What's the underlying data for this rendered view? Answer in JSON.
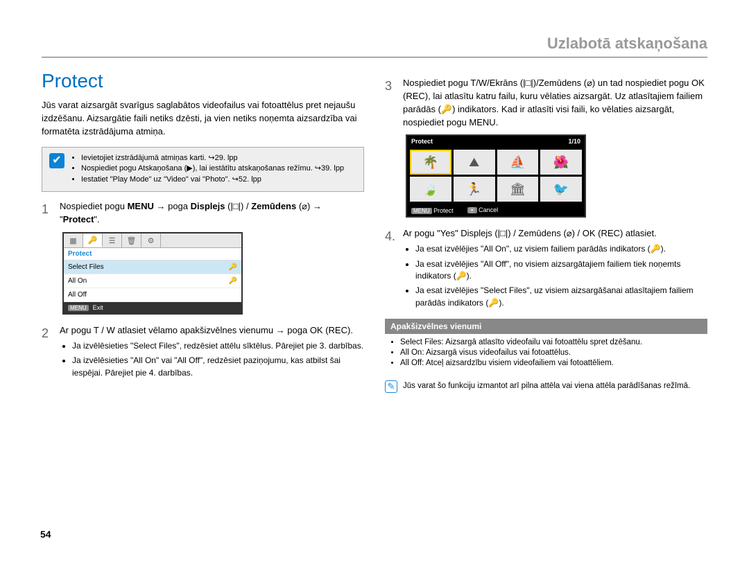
{
  "header": {
    "breadcrumb": "Uzlabotā atskaņošana"
  },
  "section": {
    "title": "Protect"
  },
  "intro": "Jūs varat aizsargāt svarīgus saglabātos videofailus vai fotoattēlus pret nejaušu izdzēšanu. Aizsargātie faili netiks dzēsti, ja vien netiks noņemta aizsardzība vai formatēta izstrādājuma atmiņa.",
  "infobox": {
    "items": [
      "Ievietojiet izstrādājumā atmiņas karti. ↪29. lpp",
      "Nospiediet pogu Atskaņošana (▶), lai iestātītu atskaņošanas režīmu. ↪39. lpp",
      "Iestatiet \"Play Mode\" uz \"Video\" vai \"Photo\". ↪52. lpp"
    ]
  },
  "step1": {
    "num": "1",
    "text_before": "Nospiediet pogu ",
    "bold1": "MENU",
    "arrow1": " → poga ",
    "bold2": "Displejs",
    "disp_icon": " (|□|) / ",
    "bold3": "Zemūdens",
    "after": " (⌀) → \"",
    "bold4": "Protect",
    "end": "\"."
  },
  "menu1": {
    "title": "Protect",
    "items": [
      "Select Files",
      "All On",
      "All Off"
    ],
    "exit": "Exit",
    "menu_key": "MENU"
  },
  "step2": {
    "num": "2",
    "text": "Ar pogu T / W atlasiet vēlamo apakšizvēlnes vienumu → poga OK (REC).",
    "bullets": [
      "Ja izvēlēsieties \"Select Files\", redzēsiet attēlu sīktēlus. Pārejiet pie 3. darbības.",
      "Ja izvēlēsieties \"All On\" vai \"All Off\", redzēsiet paziņojumu, kas atbilst šai iespējai. Pārejiet pie 4. darbības."
    ]
  },
  "step3": {
    "num": "3",
    "text": "Nospiediet pogu T/W/Ekrāns (|□|)/Zemūdens (⌀) un tad nospiediet pogu OK (REC), lai atlasītu katru failu, kuru vēlaties aizsargāt. Uz atlasītajiem failiem parādās (🔑) indikators. Kad ir atlasīti visi faili, ko vēlaties aizsargāt, nospiediet pogu MENU."
  },
  "thumbs": {
    "title": "Protect",
    "counter": "1/10",
    "protect": "Protect",
    "cancel": "Cancel",
    "menu_key": "MENU"
  },
  "step4": {
    "num": "4.",
    "text": "Ar pogu \"Yes\" Displejs (|□|) / Zemūdens (⌀) / OK (REC) atlasiet.",
    "bullets": [
      "Ja esat izvēlējies \"All On\", uz visiem failiem parādās indikators (🔑).",
      "Ja esat izvēlējies \"All Off\", no visiem aizsargātajiem failiem tiek noņemts indikators (🔑).",
      "Ja esat izvēlējies \"Select Files\", uz visiem aizsargāšanai atlasītajiem failiem parādās indikators (🔑)."
    ]
  },
  "submenu": {
    "header": "Apakšizvēlnes vienumi",
    "items": [
      "Select Files: Aizsargā atlasīto videofailu vai fotoattēlu spret dzēšanu.",
      "All On: Aizsargā visus videofailus vai fotoattēlus.",
      "All Off: Atceļ aizsardzību visiem videofailiem vai fotoattēliem."
    ]
  },
  "note": "Jūs varat šo funkciju izmantot arī pilna attēla vai viena attēla parādīšanas režīmā.",
  "page_number": "54"
}
